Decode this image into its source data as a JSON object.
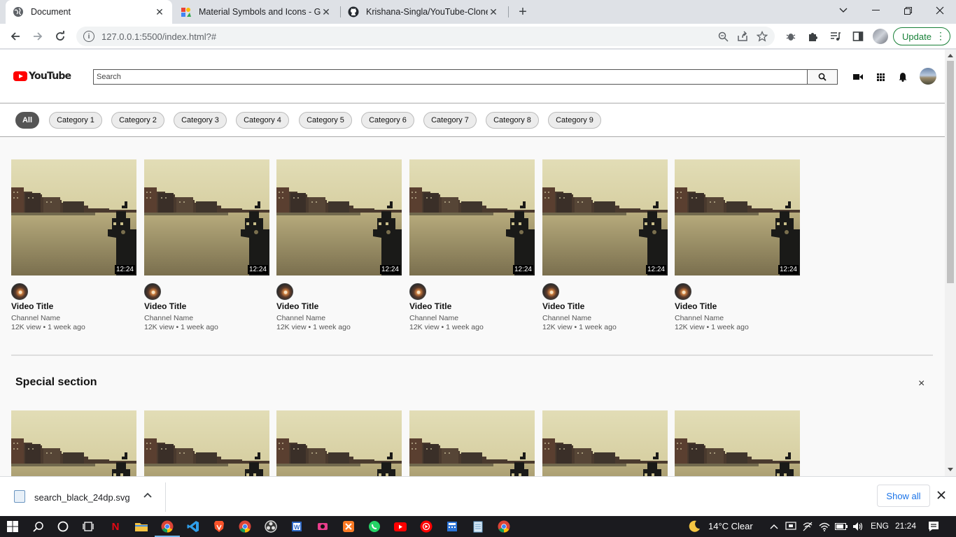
{
  "browser": {
    "tabs": [
      {
        "title": "Document",
        "active": true
      },
      {
        "title": "Material Symbols and Icons - Goo",
        "active": false
      },
      {
        "title": "Krishana-Singla/YouTube-Clone",
        "active": false
      }
    ],
    "url": "127.0.0.1:5500/index.html?#",
    "update_label": "Update"
  },
  "page": {
    "logo_text": "YouTube",
    "search_placeholder": "Search",
    "categories": [
      "All",
      "Category 1",
      "Category 2",
      "Category 3",
      "Category 4",
      "Category 5",
      "Category 6",
      "Category 7",
      "Category 8",
      "Category 9"
    ],
    "videos": [
      {
        "title": "Video Title",
        "channel": "Channel Name",
        "meta": "12K view • 1 week ago",
        "duration": "12:24"
      },
      {
        "title": "Video Title",
        "channel": "Channel Name",
        "meta": "12K view • 1 week ago",
        "duration": "12:24"
      },
      {
        "title": "Video Title",
        "channel": "Channel Name",
        "meta": "12K view • 1 week ago",
        "duration": "12:24"
      },
      {
        "title": "Video Title",
        "channel": "Channel Name",
        "meta": "12K view • 1 week ago",
        "duration": "12:24"
      },
      {
        "title": "Video Title",
        "channel": "Channel Name",
        "meta": "12K view • 1 week ago",
        "duration": "12:24"
      },
      {
        "title": "Video Title",
        "channel": "Channel Name",
        "meta": "12K view • 1 week ago",
        "duration": "12:24"
      }
    ],
    "special_section": {
      "title": "Special section",
      "close_glyph": "×",
      "thumbnail_count": 6
    }
  },
  "download_bar": {
    "file_name": "search_black_24dp.svg",
    "show_all_label": "Show all"
  },
  "taskbar": {
    "weather": "14°C  Clear",
    "language": "ENG",
    "time": "21:24"
  }
}
